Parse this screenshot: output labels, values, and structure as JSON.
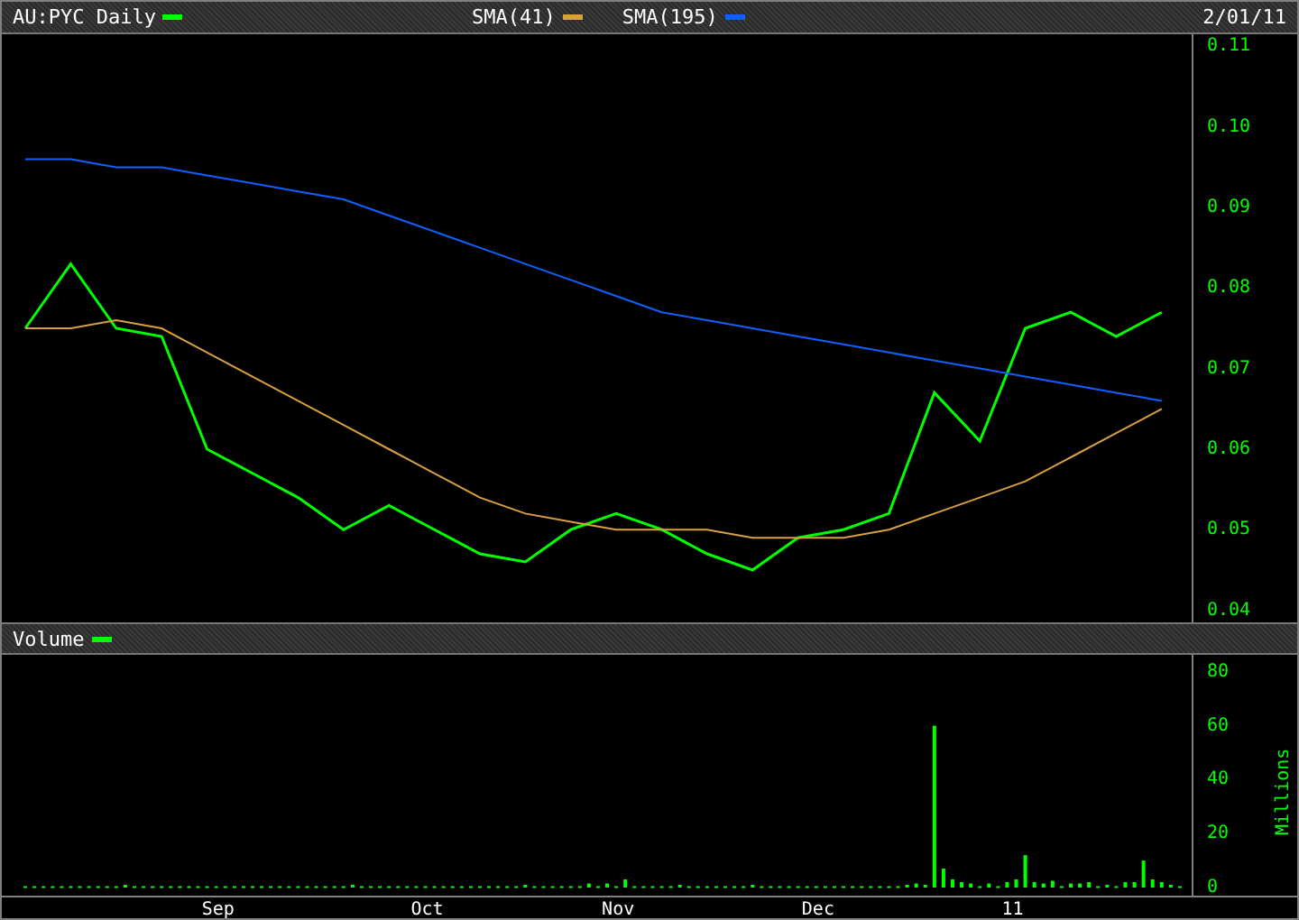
{
  "header": {
    "date": "2/01/11"
  },
  "price_chart": {
    "chart_data": {
      "type": "line",
      "categories": [
        null,
        null,
        null,
        null,
        null,
        null,
        null,
        null,
        null,
        null,
        null,
        null,
        null,
        null,
        null,
        null,
        null,
        null,
        null,
        null,
        null,
        null,
        null,
        null,
        null,
        null
      ],
      "ylim": [
        0.0385,
        0.1115
      ],
      "yticks": [
        {
          "value": 0.04,
          "label": "0.04"
        },
        {
          "value": 0.05,
          "label": "0.05"
        },
        {
          "value": 0.06,
          "label": "0.06"
        },
        {
          "value": 0.07,
          "label": "0.07"
        },
        {
          "value": 0.08,
          "label": "0.08"
        },
        {
          "value": 0.09,
          "label": "0.09"
        },
        {
          "value": 0.1,
          "label": "0.10"
        },
        {
          "value": 0.11,
          "label": "0.11"
        }
      ],
      "series": [
        {
          "name": "AU:PYC Daily",
          "color": "#00ff00",
          "values": [
            0.075,
            0.083,
            0.075,
            0.074,
            0.06,
            0.057,
            0.054,
            0.05,
            0.053,
            0.05,
            0.047,
            0.046,
            0.05,
            0.052,
            0.05,
            0.047,
            0.045,
            0.049,
            0.05,
            0.052,
            0.067,
            0.061,
            0.075,
            0.077,
            0.074,
            0.077
          ]
        },
        {
          "name": "SMA(41)",
          "color": "#d9a040",
          "values": [
            0.075,
            0.075,
            0.076,
            0.075,
            0.072,
            0.069,
            0.066,
            0.063,
            0.06,
            0.057,
            0.054,
            0.052,
            0.051,
            0.05,
            0.05,
            0.05,
            0.049,
            0.049,
            0.049,
            0.05,
            0.052,
            0.054,
            0.056,
            0.059,
            0.062,
            0.065
          ]
        },
        {
          "name": "SMA(195)",
          "color": "#1060ff",
          "values": [
            0.096,
            0.096,
            0.095,
            0.095,
            0.094,
            0.093,
            0.092,
            0.091,
            0.089,
            0.087,
            0.085,
            0.083,
            0.081,
            0.079,
            0.077,
            0.076,
            0.075,
            0.074,
            0.073,
            0.072,
            0.071,
            0.07,
            0.069,
            0.068,
            0.067,
            0.066
          ]
        }
      ]
    }
  },
  "volume_panel": {
    "chart_data": {
      "type": "bar",
      "ylabel": "Millions",
      "ylim": [
        0,
        86.3
      ],
      "yticks": [
        {
          "value": 0,
          "label": "0"
        },
        {
          "value": 20,
          "label": "20"
        },
        {
          "value": 40,
          "label": "40"
        },
        {
          "value": 60,
          "label": "60"
        },
        {
          "value": 80,
          "label": "80"
        }
      ],
      "categories": [
        null,
        null,
        null,
        null,
        null,
        null,
        null,
        null,
        null,
        null,
        null,
        null,
        null,
        null,
        null,
        null,
        null,
        null,
        null,
        null,
        null,
        "Sep",
        null,
        null,
        null,
        null,
        null,
        null,
        null,
        null,
        null,
        null,
        null,
        null,
        null,
        null,
        null,
        null,
        null,
        null,
        null,
        null,
        null,
        null,
        "Oct",
        null,
        null,
        null,
        null,
        null,
        null,
        null,
        null,
        null,
        null,
        null,
        null,
        null,
        null,
        null,
        null,
        null,
        null,
        null,
        null,
        "Nov",
        null,
        null,
        null,
        null,
        null,
        null,
        null,
        null,
        null,
        null,
        null,
        null,
        null,
        null,
        null,
        null,
        null,
        null,
        null,
        null,
        null,
        "Dec",
        null,
        null,
        null,
        null,
        null,
        null,
        null,
        null,
        null,
        null,
        null,
        null,
        null,
        null,
        null,
        null,
        null,
        null,
        null,
        null,
        null,
        "11",
        null,
        null,
        null,
        null,
        null,
        null,
        null,
        null,
        null,
        null,
        null,
        null,
        null,
        null,
        null,
        null,
        null,
        null
      ],
      "series": [
        {
          "name": "Volume",
          "color": "#00ff00",
          "values": [
            0.5,
            0.5,
            0.5,
            0.5,
            0.5,
            0.5,
            0.5,
            0.5,
            0.5,
            0.5,
            0.5,
            1,
            0.5,
            0.5,
            0.5,
            0.5,
            0.5,
            0.5,
            0.5,
            0.5,
            0.5,
            0.5,
            0.5,
            0.5,
            0.5,
            0.5,
            0.5,
            0.5,
            0.5,
            0.5,
            0.5,
            0.5,
            0.5,
            0.5,
            0.5,
            0.5,
            1,
            0.5,
            0.5,
            0.5,
            0.5,
            0.5,
            0.5,
            0.5,
            0.5,
            0.5,
            0.5,
            0.5,
            0.5,
            0.5,
            0.5,
            0.5,
            0.5,
            0.5,
            0.5,
            1,
            0.5,
            0.5,
            0.5,
            0.5,
            0.5,
            0.5,
            1.5,
            0.5,
            1.5,
            0.5,
            3,
            0.5,
            0.5,
            0.5,
            0.5,
            0.5,
            1,
            0.5,
            0.5,
            0.5,
            0.5,
            0.5,
            0.5,
            0.5,
            1,
            0.5,
            0.5,
            0.5,
            0.5,
            0.5,
            0.5,
            0.5,
            0.5,
            0.5,
            0.5,
            0.5,
            0.5,
            0.5,
            0.5,
            0.5,
            0.5,
            1,
            1.5,
            1,
            60,
            7,
            3,
            2,
            1.5,
            0.5,
            1.5,
            0.5,
            2,
            3,
            12,
            2,
            1.5,
            2.5,
            0.5,
            1.5,
            1.5,
            2,
            0.5,
            1,
            0.5,
            2,
            2,
            10,
            3,
            2,
            1,
            0.5
          ]
        }
      ]
    }
  }
}
